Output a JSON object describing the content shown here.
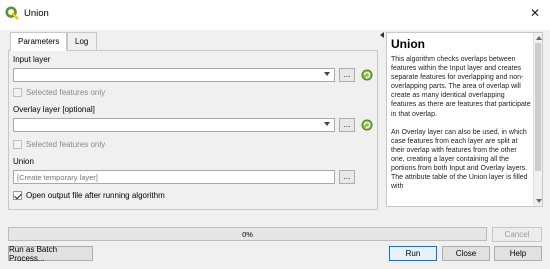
{
  "window": {
    "title": "Union",
    "close_glyph": "✕"
  },
  "tabs": [
    {
      "label": "Parameters",
      "active": true
    },
    {
      "label": "Log",
      "active": false
    }
  ],
  "params": {
    "input_layer_label": "Input layer",
    "input_layer_value": "",
    "input_selected_only": "Selected features only",
    "overlay_layer_label": "Overlay layer [optional]",
    "overlay_layer_value": "",
    "overlay_selected_only": "Selected features only",
    "union_label": "Union",
    "union_placeholder": "[Create temporary layer]",
    "open_output_label": "Open output file after running algorithm",
    "open_output_checked": true,
    "ellipsis": "..."
  },
  "help": {
    "title": "Union",
    "paragraph1": "This algorithm checks overlaps between features within the Input layer and creates separate features for overlapping and non-overlapping parts. The area of overlap will create as many identical overlapping features as there are features that participate in that overlap.",
    "paragraph2": "An Overlay layer can also be used, in which case features from each layer are split at their overlap with features from the other one, creating a layer containing all the portions from both Input and Overlay layers. The attribute table of the Union layer is filled with"
  },
  "progress": {
    "value": 0,
    "label": "0%"
  },
  "buttons": {
    "cancel": "Cancel",
    "batch": "Run as Batch Process...",
    "run": "Run",
    "close": "Close",
    "help": "Help"
  },
  "colors": {
    "qgis_green": "#589632",
    "qgis_yellow": "#eec900"
  }
}
